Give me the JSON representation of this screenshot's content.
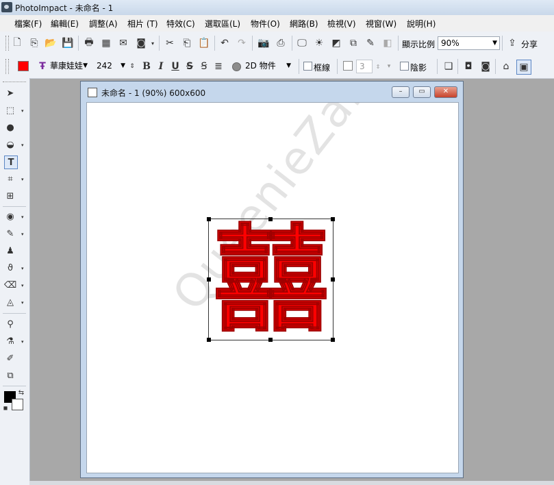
{
  "window": {
    "title": "PhotoImpact - 未命名 - 1"
  },
  "menu": {
    "items": [
      {
        "label": "檔案(F)"
      },
      {
        "label": "編輯(E)"
      },
      {
        "label": "調整(A)"
      },
      {
        "label": "相片 (T)"
      },
      {
        "label": "特效(C)"
      },
      {
        "label": "選取區(L)"
      },
      {
        "label": "物件(O)"
      },
      {
        "label": "網路(B)"
      },
      {
        "label": "檢視(V)"
      },
      {
        "label": "視窗(W)"
      },
      {
        "label": "說明(H)"
      }
    ]
  },
  "standard_toolbar": {
    "zoom_label": "顯示比例",
    "zoom_value": "90%",
    "share_label": "分享"
  },
  "text_toolbar": {
    "color": "#ff0000",
    "font_name": "華康娃娃",
    "font_size": "242",
    "bold": "B",
    "italic": "I",
    "underline": "U",
    "strike": "S",
    "object_mode": "2D 物件",
    "border_label": "框線",
    "border_width": "3",
    "shadow_label": "陰影"
  },
  "document": {
    "title": "未命名 - 1 (90%) 600x600",
    "text_object": "囍",
    "watermark": "QueenieZakka"
  },
  "colors": {
    "foreground": "#000000",
    "background": "#ffffff",
    "accent": "#ff0000"
  }
}
